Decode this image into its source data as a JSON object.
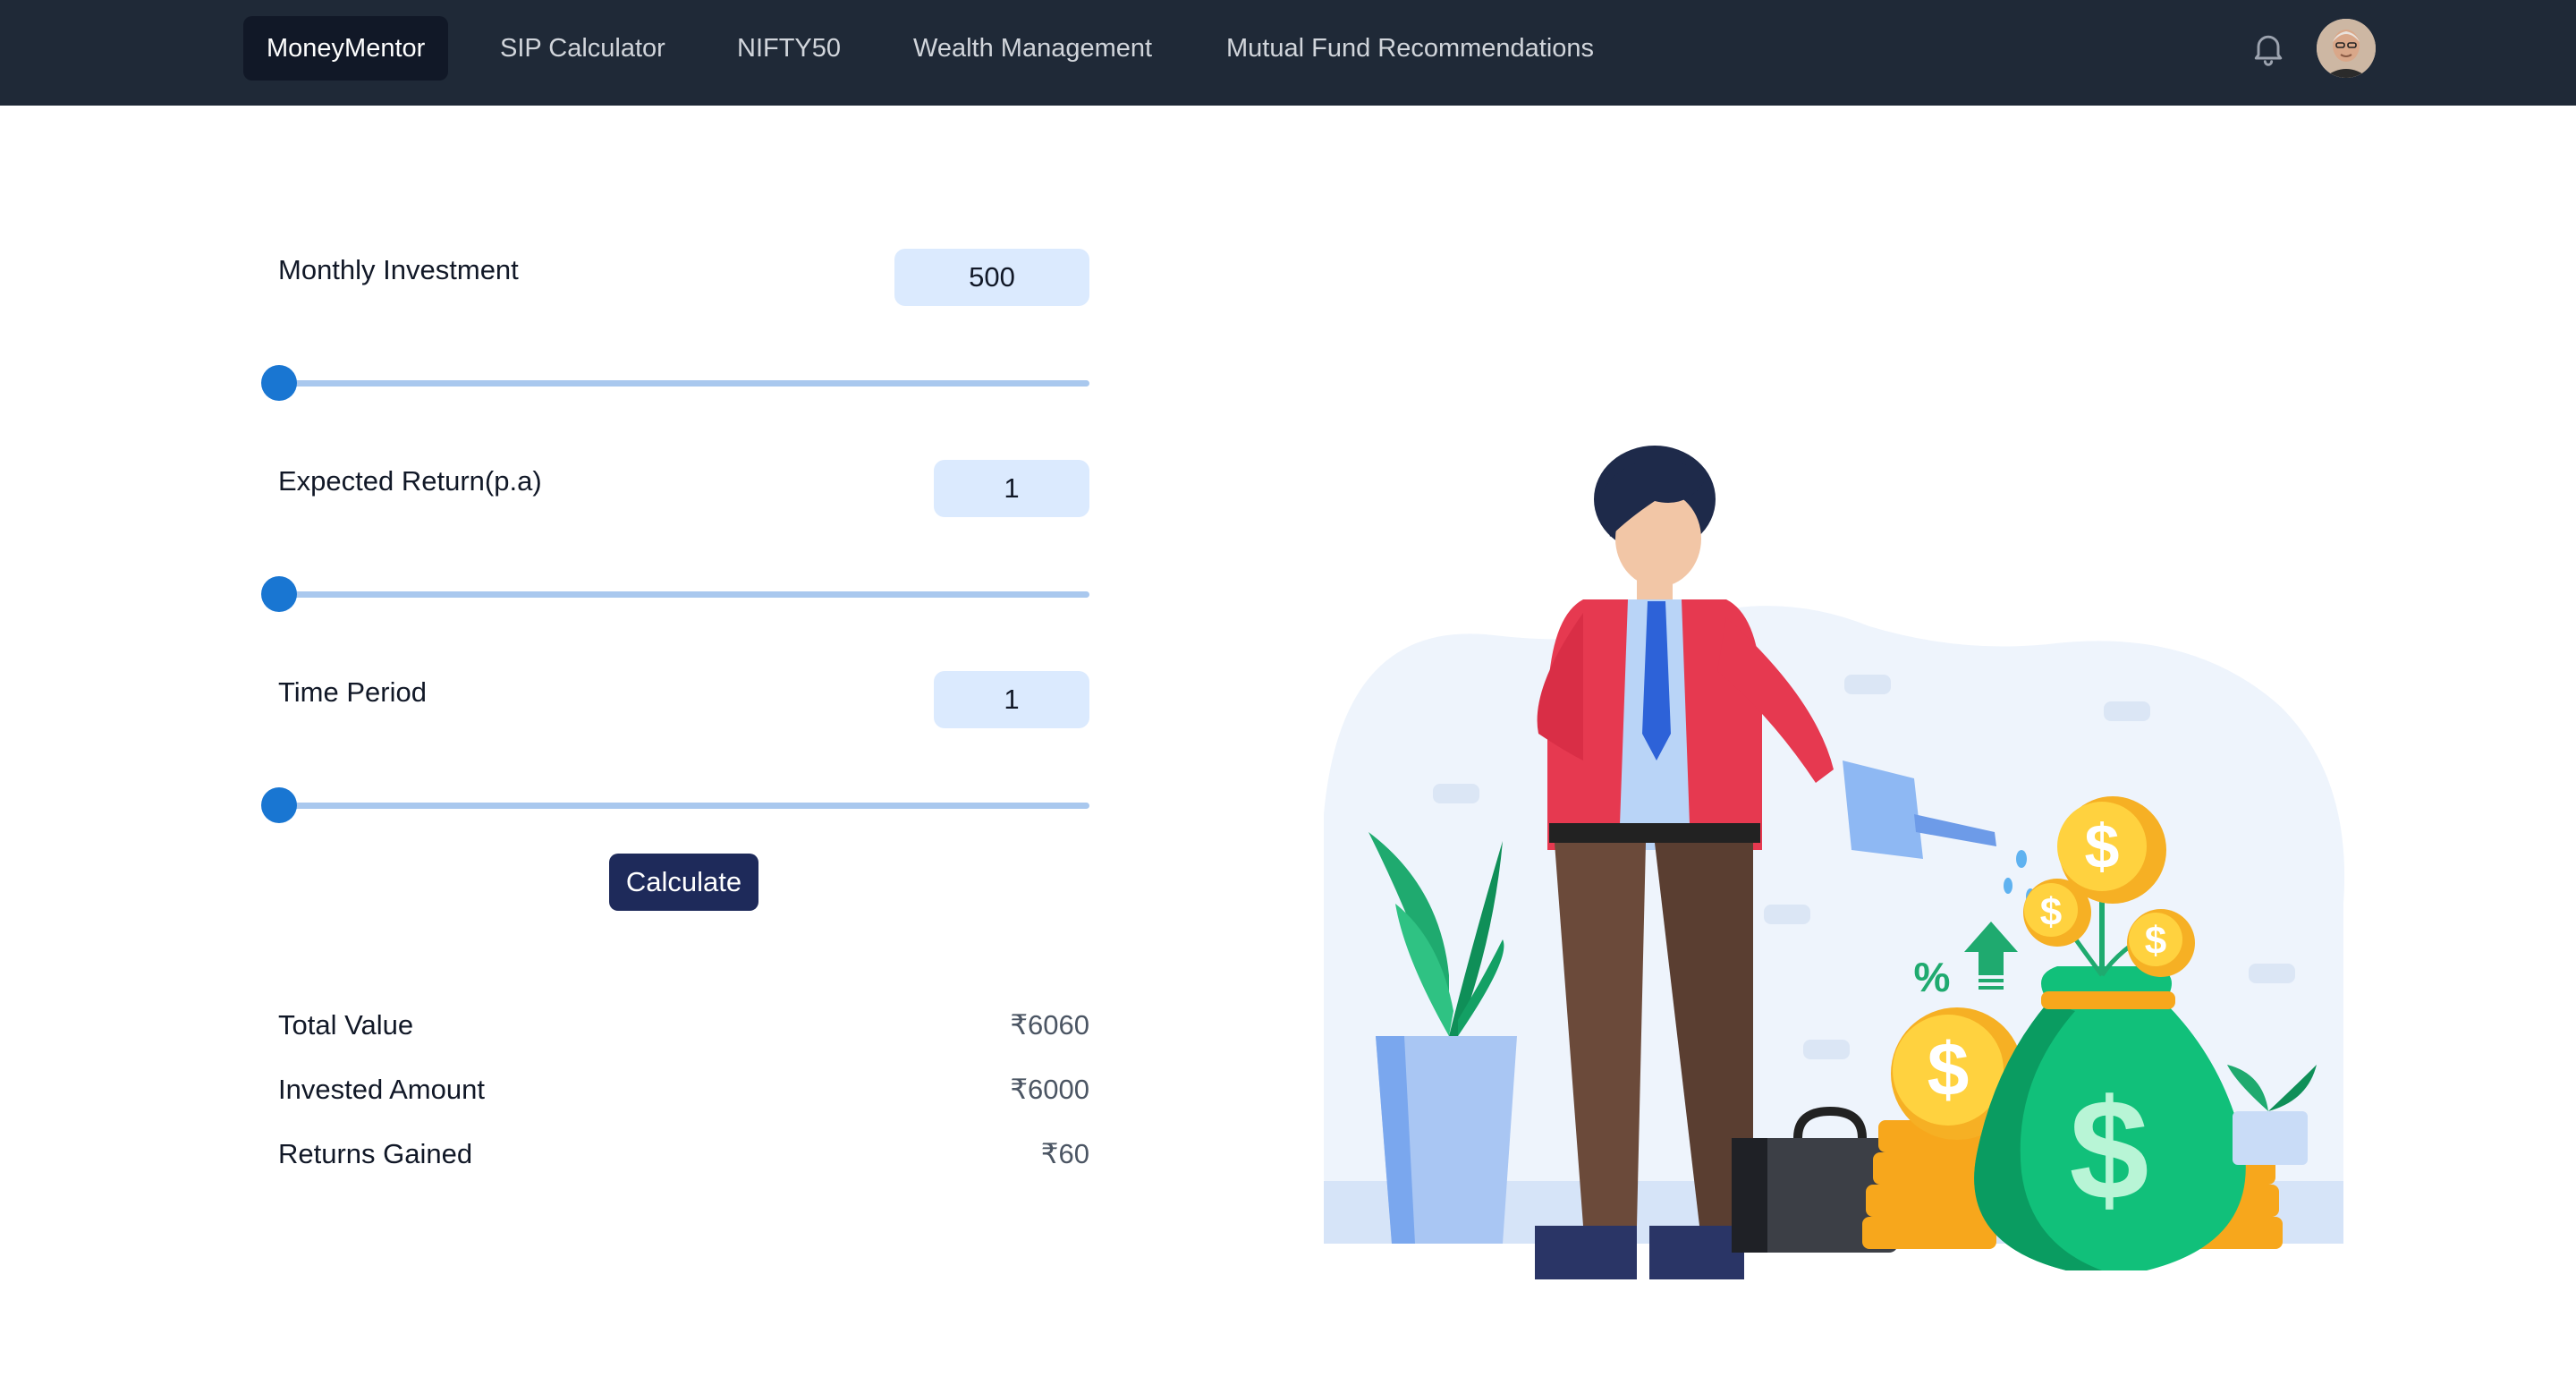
{
  "nav": {
    "brand": "MoneyMentor",
    "items": [
      {
        "label": "SIP Calculator"
      },
      {
        "label": "NIFTY50"
      },
      {
        "label": "Wealth Management"
      },
      {
        "label": "Mutual Fund Recommendations"
      }
    ]
  },
  "form": {
    "monthly_investment": {
      "label": "Monthly Investment",
      "value": "500"
    },
    "expected_return": {
      "label": "Expected Return(p.a)",
      "value": "1"
    },
    "time_period": {
      "label": "Time Period",
      "value": "1"
    },
    "calculate_label": "Calculate"
  },
  "results": {
    "total_value": {
      "label": "Total Value",
      "value": "₹6060"
    },
    "invested_amount": {
      "label": "Invested Amount",
      "value": "₹6000"
    },
    "returns_gained": {
      "label": "Returns Gained",
      "value": "₹60"
    }
  },
  "colors": {
    "navbar": "#1f2937",
    "accent": "#1976d2",
    "button": "#1e2a5a",
    "input_bg": "#dbeafe"
  }
}
